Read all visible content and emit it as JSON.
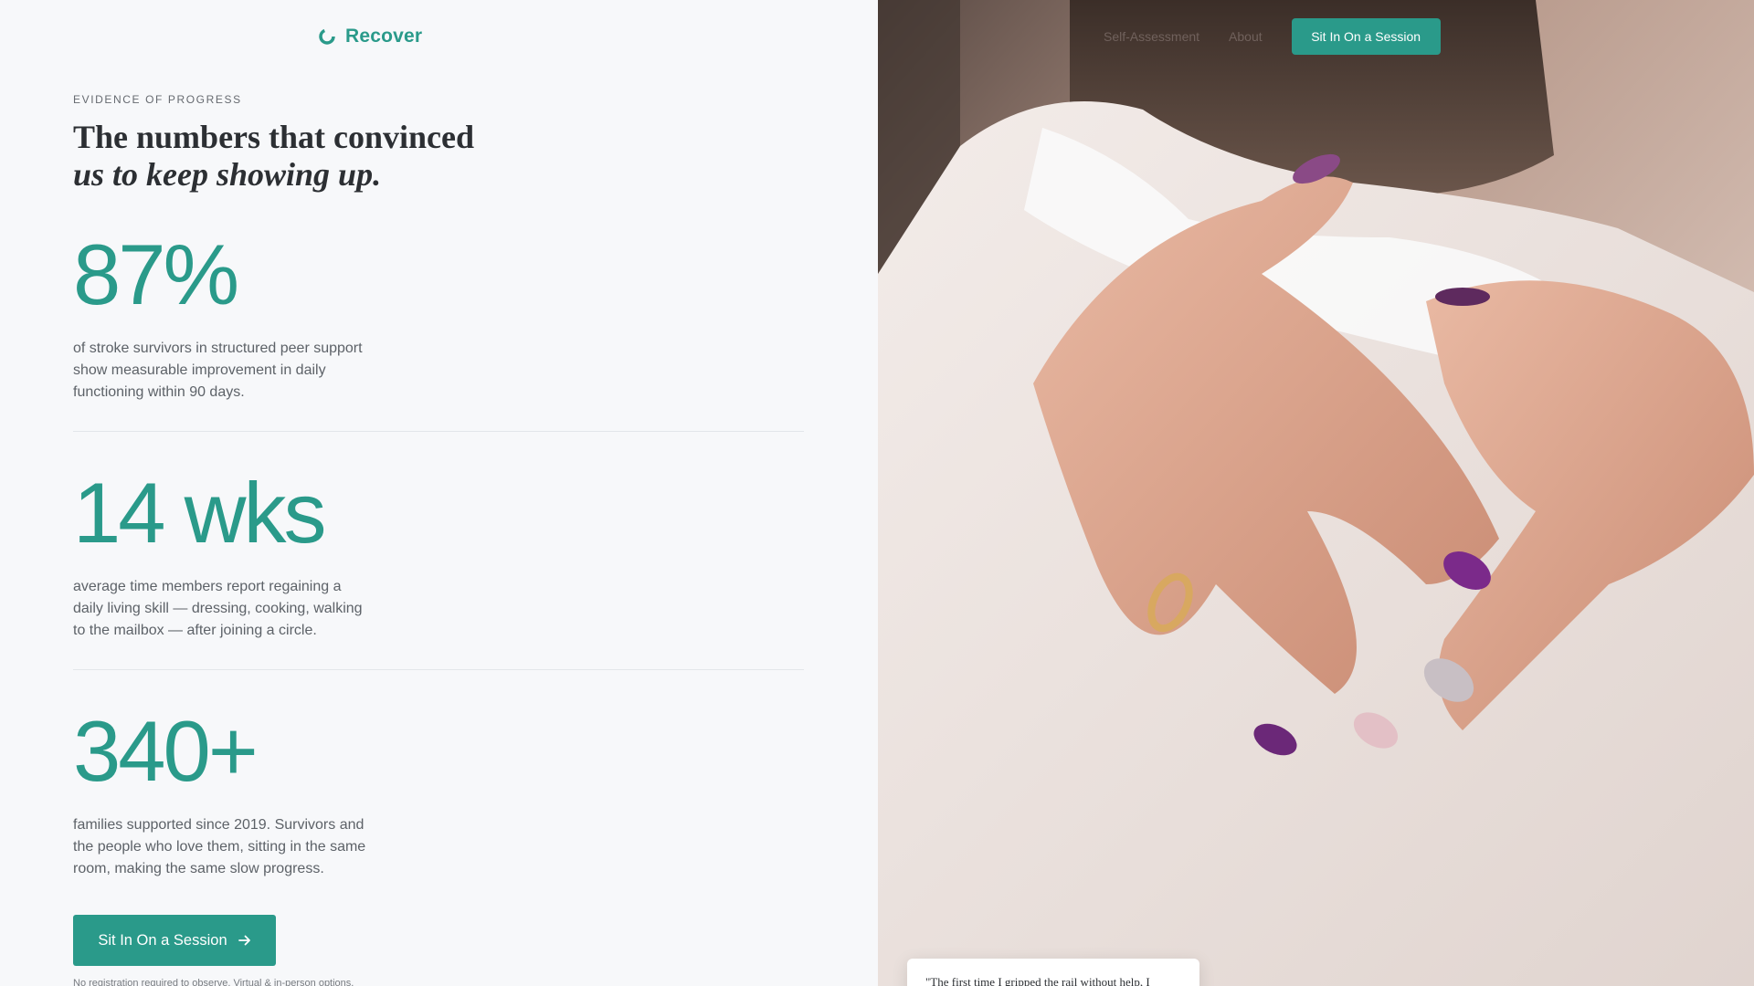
{
  "brand": {
    "name": "Recover",
    "icon": "circle-notch-logo-icon"
  },
  "nav": {
    "links": [
      "Self-Assessment",
      "About"
    ],
    "cta_label": "Sit In On a Session"
  },
  "section": {
    "eyebrow": "EVIDENCE OF PROGRESS",
    "headline_line1": "The numbers that convinced",
    "headline_line2": "us to keep showing up."
  },
  "stats": [
    {
      "value": "87%",
      "description": "of stroke survivors in structured peer support show measurable improvement in daily functioning within 90 days."
    },
    {
      "value": "14 wks",
      "description": "average time members report regaining a daily living skill — dressing, cooking, walking to the mailbox — after joining a circle."
    },
    {
      "value": "340+",
      "description": "families supported since 2019. Survivors and the people who love them, sitting in the same room, making the same slow progress."
    }
  ],
  "cta": {
    "label": "Sit In On a Session",
    "icon": "arrow-right-icon"
  },
  "note": "No registration required to observe. Virtual & in-person options.",
  "quote": {
    "text": "\"The first time I gripped the rail without help, I"
  },
  "colors": {
    "accent": "#2a9a8a",
    "background": "#f7f8fa",
    "text": "#2c2f33",
    "muted": "#5d6268"
  }
}
